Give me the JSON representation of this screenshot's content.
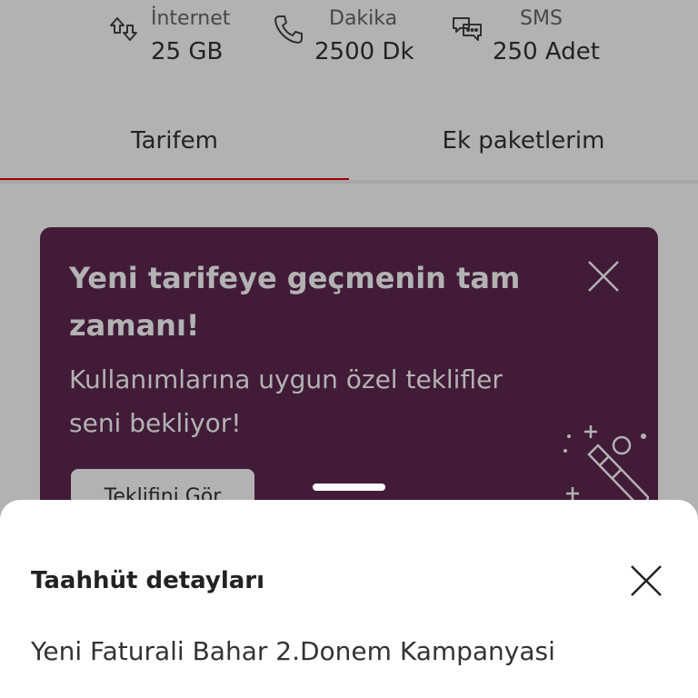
{
  "usage": {
    "internet": {
      "label": "İnternet",
      "value": "25 GB",
      "icon": "data-transfer-icon"
    },
    "minutes": {
      "label": "Dakika",
      "value": "2500 Dk",
      "icon": "phone-icon"
    },
    "sms": {
      "label": "SMS",
      "value": "250 Adet",
      "icon": "chat-bubbles-icon"
    }
  },
  "tabs": [
    {
      "label": "Tarifem",
      "active": true
    },
    {
      "label": "Ek paketlerim",
      "active": false
    }
  ],
  "promo": {
    "title": "Yeni tarifeye geçmenin tam zamanı!",
    "subtitle": "Kullanımlarına uygun özel teklifler seni bekliyor!",
    "button_label": "Teklifini Gör",
    "background_color": "#5e2750"
  },
  "sheet": {
    "title": "Taahhüt detayları",
    "body": "Yeni Faturali Bahar 2.Donem Kampanyasi"
  },
  "colors": {
    "accent": "#e60000",
    "promo_bg": "#5e2750"
  }
}
